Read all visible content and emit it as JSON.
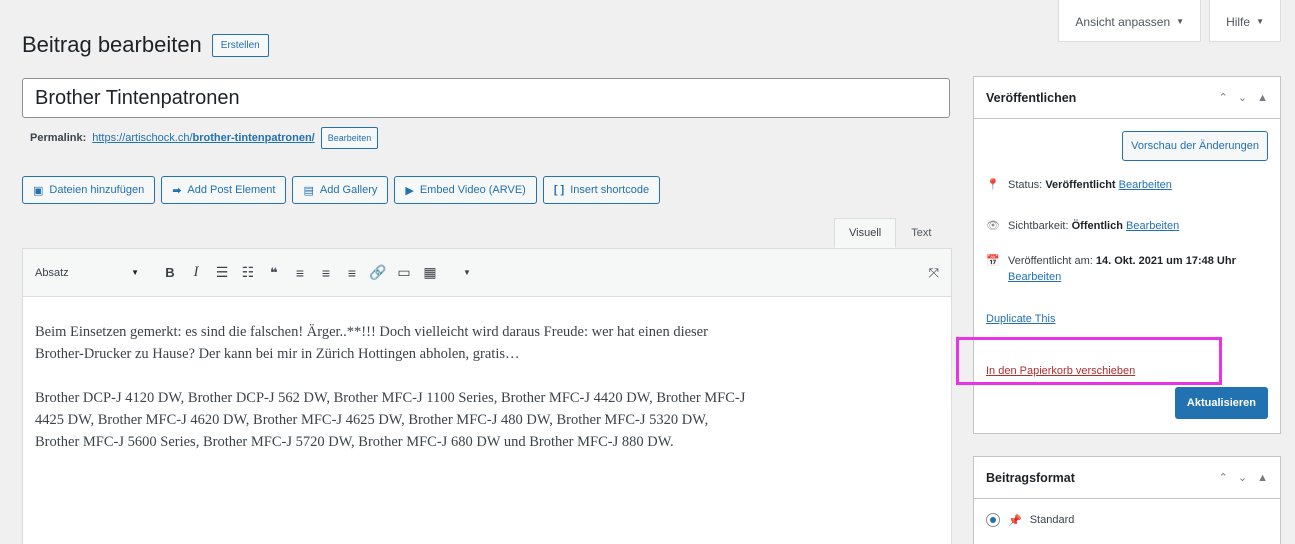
{
  "screen_meta": {
    "screen_options": "Ansicht anpassen",
    "help": "Hilfe"
  },
  "header": {
    "title": "Beitrag bearbeiten",
    "add_new": "Erstellen"
  },
  "post": {
    "title": "Brother Tintenpatronen",
    "permalink_label": "Permalink:",
    "permalink_base": "https://artischock.ch/",
    "permalink_slug": "brother-tintenpatronen/",
    "permalink_edit": "Bearbeiten"
  },
  "media_buttons": [
    {
      "label": "Dateien hinzufügen",
      "icon": "media-icon"
    },
    {
      "label": "Add Post Element",
      "icon": "post-element-icon"
    },
    {
      "label": "Add Gallery",
      "icon": "gallery-icon"
    },
    {
      "label": "Embed Video (ARVE)",
      "icon": "video-icon"
    },
    {
      "label": "Insert shortcode",
      "icon": "shortcode-icon"
    }
  ],
  "editor": {
    "tab_visual": "Visuell",
    "tab_text": "Text",
    "format_select": "Absatz",
    "paragraphs": [
      "Beim Einsetzen gemerkt: es sind die falschen! Ärger..**!!! Doch vielleicht wird daraus Freude: wer hat einen dieser Brother-Drucker zu Hause? Der kann bei mir in Zürich Hottingen abholen, gratis…",
      "Brother DCP-J 4120 DW, Brother DCP-J 562 DW, Brother MFC-J 1100 Series, Brother MFC-J 4420 DW, Brother MFC-J 4425 DW, Brother MFC-J 4620 DW, Brother MFC-J 4625 DW, Brother MFC-J 480 DW, Brother MFC-J 5320 DW, Brother MFC-J 5600 Series, Brother MFC-J 5720 DW, Brother MFC-J 680 DW und Brother MFC-J 880 DW."
    ]
  },
  "publish": {
    "title": "Veröffentlichen",
    "preview": "Vorschau der Änderungen",
    "status_label": "Status:",
    "status_value": "Veröffentlicht",
    "visibility_label": "Sichtbarkeit:",
    "visibility_value": "Öffentlich",
    "published_label": "Veröffentlicht am:",
    "published_value": "14. Okt. 2021 um 17:48 Uhr",
    "edit": "Bearbeiten",
    "duplicate": "Duplicate This",
    "trash": "In den Papierkorb verschieben",
    "update": "Aktualisieren"
  },
  "format": {
    "title": "Beitragsformat",
    "standard": "Standard"
  },
  "colors": {
    "accent": "#2271b1",
    "highlight": "#e833e8",
    "trash": "#b32d2e"
  }
}
